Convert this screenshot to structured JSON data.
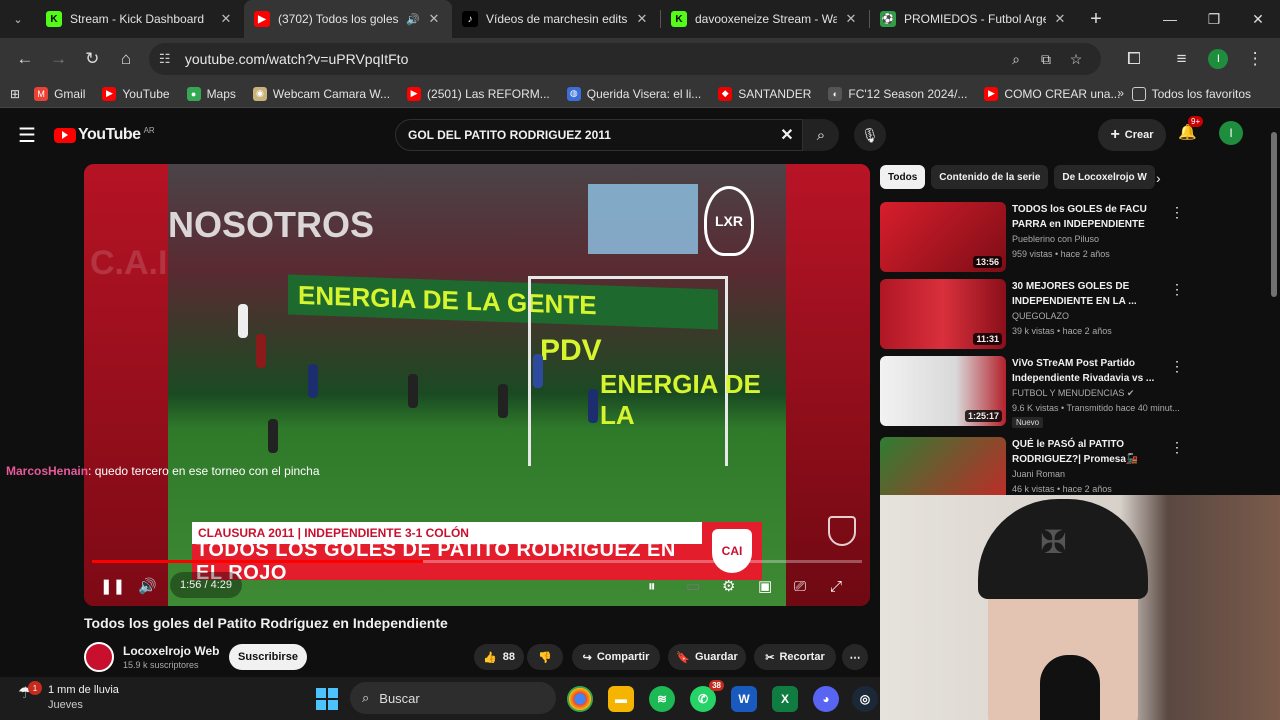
{
  "browser": {
    "tabs": [
      {
        "title": "Stream - Kick Dashboard",
        "favicon": "kick-icon",
        "active": false
      },
      {
        "title": "(3702) Todos los goles del",
        "favicon": "youtube-icon",
        "active": true
      },
      {
        "title": "Vídeos de marchesin edits b",
        "favicon": "tiktok-icon",
        "active": false
      },
      {
        "title": "davooxeneize Stream - Watc",
        "favicon": "kick-icon",
        "active": false
      },
      {
        "title": "PROMIEDOS - Futbol Argent",
        "favicon": "promiedos-icon",
        "active": false
      }
    ],
    "url": "youtube.com/watch?v=uPRVpqItFto",
    "profile_initial": "I",
    "bookmarks": [
      {
        "label": "Gmail",
        "icon": "gmail-icon",
        "color": "#ea4335"
      },
      {
        "label": "YouTube",
        "icon": "youtube-icon",
        "color": "#ff0000"
      },
      {
        "label": "Maps",
        "icon": "maps-icon",
        "color": "#34a853"
      },
      {
        "label": "Webcam Camara W...",
        "icon": "webcam-icon",
        "color": "#c9b37a"
      },
      {
        "label": "(2501) Las REFORM...",
        "icon": "youtube-icon",
        "color": "#ff0000"
      },
      {
        "label": "Querida Visera: el li...",
        "icon": "globe-icon",
        "color": "#3b6fd6"
      },
      {
        "label": "SANTANDER",
        "icon": "santander-icon",
        "color": "#ec0000"
      },
      {
        "label": "FC'12 Season 2024/...",
        "icon": "github-icon",
        "color": "#555555"
      },
      {
        "label": "COMO CREAR una...",
        "icon": "youtube-icon",
        "color": "#ff0000"
      }
    ],
    "all_bookmarks": "Todos los favoritos"
  },
  "youtube": {
    "country_code": "AR",
    "search_query": "GOL DEL PATITO RODRIGUEZ 2011",
    "create_label": "Crear",
    "notifications_badge": "9+",
    "avatar_initial": "I"
  },
  "player": {
    "overlay_top": "CLAUSURA 2011 | INDEPENDIENTE 3-1 COLÓN",
    "overlay_main": "TODOS LOS GOLES DE PATITO RODRÍGUEZ EN EL ROJO",
    "watermark": "LXR",
    "time": "1:56 / 4:29",
    "progress": 0.43,
    "banner_1": "ENERGIA DE LA GENTE",
    "banner_2": "ENERGIA DE LA",
    "banner_3": "PDV",
    "banner_4": "NOSOTROS"
  },
  "chat": {
    "user": "MarcosHenain",
    "message": ": quedo tercero en ese torneo con el pincha"
  },
  "video": {
    "title": "Todos los goles del Patito Rodríguez en Independiente",
    "channel": "Locoxelrojo Web",
    "subs": "15.9 k suscriptores",
    "subscribe": "Suscribirse",
    "likes": "88",
    "share": "Compartir",
    "save": "Guardar",
    "clip": "Recortar"
  },
  "sidebar": {
    "chips": [
      "Todos",
      "Contenido de la serie",
      "De Locoxelrojo W"
    ],
    "recommendations": [
      {
        "title": "TODOS los GOLES de FACU PARRA en INDEPENDIENTE",
        "channel": "Pueblerino con Piluso",
        "meta": "959 vistas • hace 2 años",
        "duration": "13:56",
        "new": ""
      },
      {
        "title": "30 MEJORES GOLES DE INDEPENDIENTE EN LA ...",
        "channel": "QUEGOLAZO",
        "meta": "39 k vistas • hace 2 años",
        "duration": "11:31",
        "new": ""
      },
      {
        "title": "ViVo STreAM Post Partido Independiente Rivadavia vs ...",
        "channel": "FUTBOL Y MENUDENCIAS ✔",
        "meta": "9.6 K vistas • Transmitido hace 40 minut...",
        "duration": "1:25:17",
        "new": "Nuevo"
      },
      {
        "title": "QUÉ le PASÓ al PATITO RODRIGUEZ?| Promesa🚂",
        "channel": "Juani Roman",
        "meta": "46 k vistas • hace 2 años",
        "duration": "",
        "new": ""
      }
    ]
  },
  "taskbar": {
    "weather": "1 mm de lluvia",
    "day": "Jueves",
    "weather_badge": "1",
    "search": "Buscar",
    "whatsapp_badge": "38"
  }
}
